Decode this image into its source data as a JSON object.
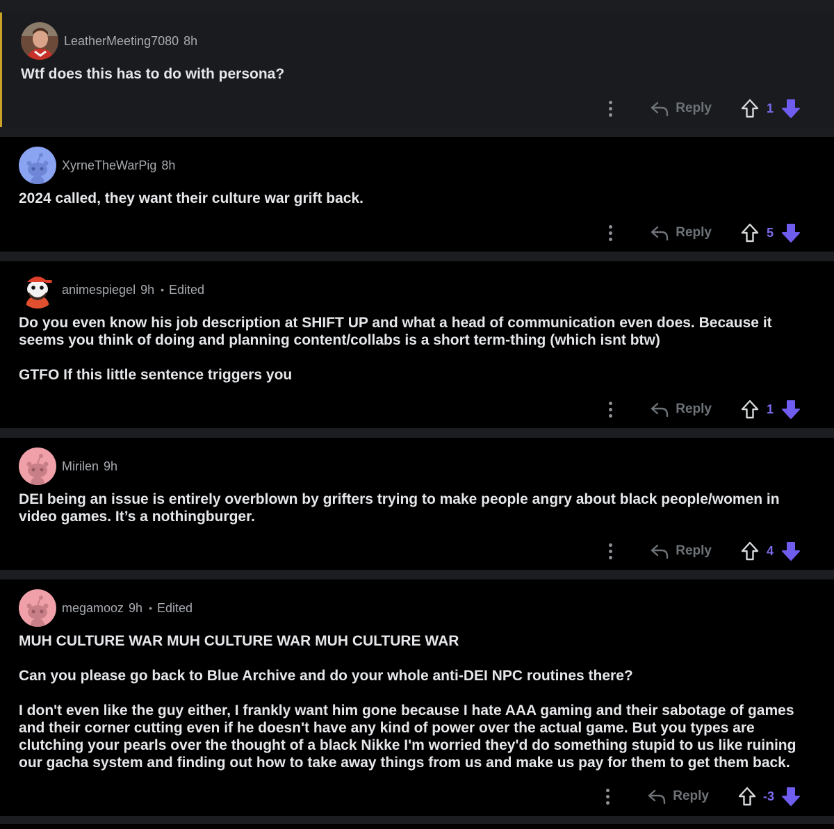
{
  "comments": [
    {
      "author": "LeatherMeeting7080",
      "age": "8h",
      "edited": "",
      "avatar": "photo-avatar",
      "paragraphs": [
        "Wtf does this has to do with persona?"
      ],
      "reply_label": "Reply",
      "score": "1"
    },
    {
      "author": "XyrneTheWarPig",
      "age": "8h",
      "edited": "",
      "avatar": "snoo-blue-avatar",
      "paragraphs": [
        "2024 called, they want their culture war grift back."
      ],
      "reply_label": "Reply",
      "score": "5"
    },
    {
      "author": "animespiegel",
      "age": "9h",
      "edited": "Edited",
      "avatar": "snoo-bearded-cap-avatar",
      "paragraphs": [
        "Do you even know his job description at SHIFT UP and what a head of communication even does. Because it seems you think of doing and planning content/collabs is a short term-thing (which isnt btw)",
        "GTFO If this little sentence triggers you"
      ],
      "reply_label": "Reply",
      "score": "1"
    },
    {
      "author": "Mirilen",
      "age": "9h",
      "edited": "",
      "avatar": "snoo-pink-avatar",
      "paragraphs": [
        "DEI being an issue is entirely overblown by grifters trying to make people angry about black people/women in video games. It’s a nothingburger."
      ],
      "reply_label": "Reply",
      "score": "4"
    },
    {
      "author": "megamooz",
      "age": "9h",
      "edited": "Edited",
      "avatar": "snoo-pink-avatar",
      "paragraphs": [
        "MUH CULTURE WAR MUH CULTURE WAR MUH CULTURE WAR",
        "Can you please go back to Blue Archive and do your whole anti-DEI NPC routines there?",
        "I don't even like the guy either, I frankly want him gone because I hate AAA gaming and their sabotage of games and their corner cutting even if he doesn't have any kind of power over the actual game. But you types are clutching your pearls over the thought of a black Nikke I'm worried they'd do something stupid to us like ruining our gacha system and finding out how to take away things from us and make us pay for them to get them back."
      ],
      "reply_label": "Reply",
      "score": "-3"
    }
  ],
  "colors": {
    "accent": "#7b6cf0",
    "highlight_bar": "#c9a227",
    "text": "#e5e7ea",
    "muted": "#9a9ea3"
  }
}
